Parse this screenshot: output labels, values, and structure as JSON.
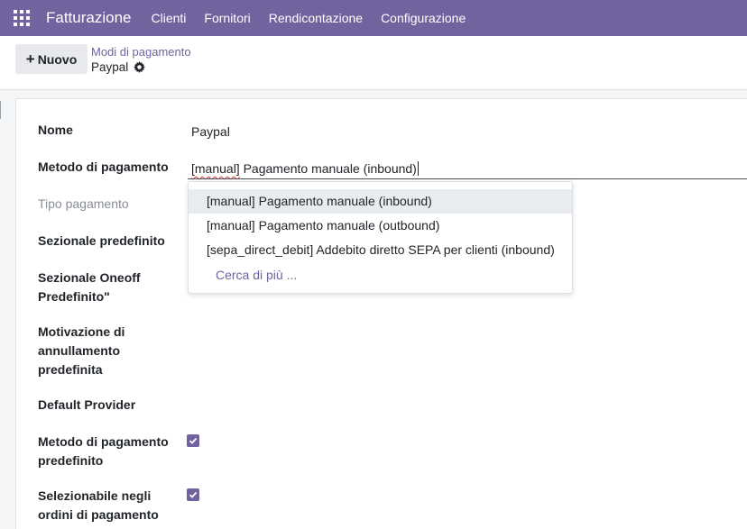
{
  "navbar": {
    "app_name": "Fatturazione",
    "menu": [
      "Clienti",
      "Fornitori",
      "Rendicontazione",
      "Configurazione"
    ],
    "color": "#71639e"
  },
  "control_panel": {
    "new_button": "Nuovo",
    "breadcrumb": "Modi di pagamento",
    "record_name": "Paypal"
  },
  "form": {
    "fields": {
      "nome": {
        "label": "Nome",
        "value": "Paypal"
      },
      "metodo": {
        "label": "Metodo di pagamento",
        "value_tag": "[manual]",
        "value_rest": " Pagamento manuale (inbound)"
      },
      "tipo": {
        "label": "Tipo pagamento"
      },
      "sezionale": {
        "label": "Sezionale predefinito"
      },
      "oneoff": {
        "label_line1": "Sezionale Oneoff",
        "label_line2": "Predefinito\""
      },
      "motivazione": {
        "label_line1": "Motivazione di",
        "label_line2": "annullamento",
        "label_line3": "predefinita"
      },
      "provider": {
        "label": "Default Provider"
      },
      "metodo_predef": {
        "label_line1": "Metodo di pagamento",
        "label_line2": "predefinito",
        "checked": true
      },
      "selezionabile": {
        "label_line1": "Selezionabile negli",
        "label_line2": "ordini di pagamento",
        "checked": true
      }
    }
  },
  "dropdown": {
    "options": [
      "[manual] Pagamento manuale (inbound)",
      "[manual] Pagamento manuale (outbound)",
      "[sepa_direct_debit] Addebito diretto SEPA per clienti (inbound)"
    ],
    "search_more": "Cerca di più ..."
  }
}
